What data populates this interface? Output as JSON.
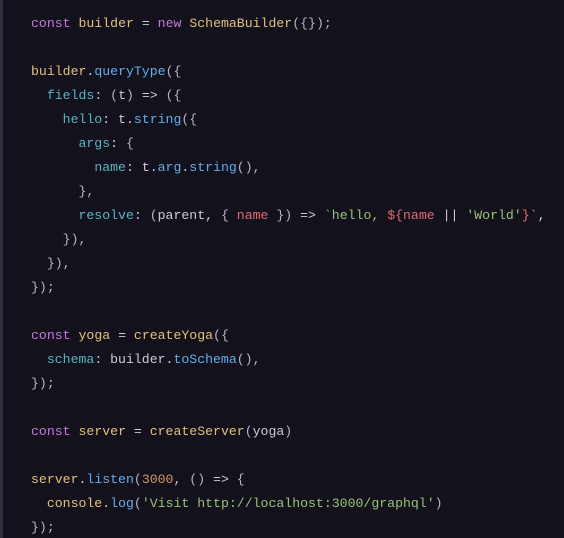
{
  "code_tokens": [
    [
      [
        "kw",
        "const"
      ],
      [
        "plain",
        " "
      ],
      [
        "ident",
        "builder"
      ],
      [
        "plain",
        " = "
      ],
      [
        "kw",
        "new"
      ],
      [
        "plain",
        " "
      ],
      [
        "ident",
        "SchemaBuilder"
      ],
      [
        "paren",
        "({});"
      ]
    ],
    [],
    [
      [
        "ident",
        "builder"
      ],
      [
        "plain",
        "."
      ],
      [
        "method",
        "queryType"
      ],
      [
        "paren",
        "({"
      ]
    ],
    [
      [
        "plain",
        "  "
      ],
      [
        "prop",
        "fields"
      ],
      [
        "plain",
        ": "
      ],
      [
        "paren",
        "("
      ],
      [
        "plain",
        "t"
      ],
      [
        "paren",
        ")"
      ],
      [
        "plain",
        " => "
      ],
      [
        "paren",
        "({"
      ]
    ],
    [
      [
        "plain",
        "    "
      ],
      [
        "prop",
        "hello"
      ],
      [
        "plain",
        ": t."
      ],
      [
        "method",
        "string"
      ],
      [
        "paren",
        "({"
      ]
    ],
    [
      [
        "plain",
        "      "
      ],
      [
        "prop",
        "args"
      ],
      [
        "plain",
        ": "
      ],
      [
        "paren",
        "{"
      ]
    ],
    [
      [
        "plain",
        "        "
      ],
      [
        "prop",
        "name"
      ],
      [
        "plain",
        ": t."
      ],
      [
        "method",
        "arg"
      ],
      [
        "plain",
        "."
      ],
      [
        "method",
        "string"
      ],
      [
        "paren",
        "(),"
      ]
    ],
    [
      [
        "plain",
        "      "
      ],
      [
        "paren",
        "},"
      ]
    ],
    [
      [
        "plain",
        "      "
      ],
      [
        "prop",
        "resolve"
      ],
      [
        "plain",
        ": "
      ],
      [
        "paren",
        "("
      ],
      [
        "plain",
        "parent, "
      ],
      [
        "paren",
        "{"
      ],
      [
        "plain",
        " "
      ],
      [
        "name2",
        "name"
      ],
      [
        "plain",
        " "
      ],
      [
        "paren",
        "}"
      ],
      [
        "paren",
        ")"
      ],
      [
        "plain",
        " => "
      ],
      [
        "tmpl",
        "`hello, "
      ],
      [
        "interp",
        "${"
      ],
      [
        "name2",
        "name"
      ],
      [
        "plain",
        " || "
      ],
      [
        "str",
        "'World'"
      ],
      [
        "interp",
        "}"
      ],
      [
        "tmpl",
        "`"
      ],
      [
        "plain",
        ","
      ]
    ],
    [
      [
        "plain",
        "    "
      ],
      [
        "paren",
        "}),"
      ]
    ],
    [
      [
        "plain",
        "  "
      ],
      [
        "paren",
        "}),"
      ]
    ],
    [
      [
        "paren",
        "});"
      ]
    ],
    [],
    [
      [
        "kw",
        "const"
      ],
      [
        "plain",
        " "
      ],
      [
        "ident",
        "yoga"
      ],
      [
        "plain",
        " = "
      ],
      [
        "ident",
        "createYoga"
      ],
      [
        "paren",
        "({"
      ]
    ],
    [
      [
        "plain",
        "  "
      ],
      [
        "prop",
        "schema"
      ],
      [
        "plain",
        ": builder."
      ],
      [
        "method",
        "toSchema"
      ],
      [
        "paren",
        "(),"
      ]
    ],
    [
      [
        "paren",
        "});"
      ]
    ],
    [],
    [
      [
        "kw",
        "const"
      ],
      [
        "plain",
        " "
      ],
      [
        "ident",
        "server"
      ],
      [
        "plain",
        " = "
      ],
      [
        "ident",
        "createServer"
      ],
      [
        "paren",
        "("
      ],
      [
        "plain",
        "yoga"
      ],
      [
        "paren",
        ")"
      ]
    ],
    [],
    [
      [
        "ident",
        "server"
      ],
      [
        "plain",
        "."
      ],
      [
        "method",
        "listen"
      ],
      [
        "paren",
        "("
      ],
      [
        "num",
        "3000"
      ],
      [
        "plain",
        ", "
      ],
      [
        "paren",
        "()"
      ],
      [
        "plain",
        " => "
      ],
      [
        "paren",
        "{"
      ]
    ],
    [
      [
        "plain",
        "  "
      ],
      [
        "ident",
        "console"
      ],
      [
        "plain",
        "."
      ],
      [
        "method",
        "log"
      ],
      [
        "paren",
        "("
      ],
      [
        "str",
        "'Visit http://localhost:3000/graphql'"
      ],
      [
        "paren",
        ")"
      ]
    ],
    [
      [
        "paren",
        "});"
      ]
    ]
  ]
}
